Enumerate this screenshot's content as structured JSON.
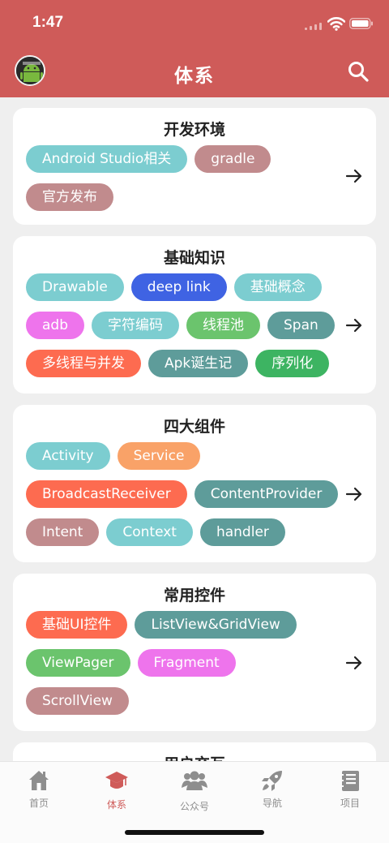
{
  "status_bar": {
    "time": "1:47"
  },
  "header": {
    "title": "体系"
  },
  "colors": {
    "primary": "#cf5b59",
    "teal_light": "#7ccdd0",
    "rose": "#c18b8d",
    "blue": "#3f63e3",
    "pink": "#ee74ec",
    "green": "#6bc46d",
    "teal_dark": "#5e9c9a",
    "orange_red": "#fd6b50",
    "green_dark": "#3db462",
    "orange": "#f9a268"
  },
  "cards": [
    {
      "title": "开发环境",
      "rows": [
        [
          "Android Studio相关",
          "gradle"
        ],
        [
          "官方发布"
        ]
      ]
    },
    {
      "title": "基础知识",
      "rows": [
        [
          "Drawable",
          "deep link",
          "基础概念"
        ],
        [
          "adb",
          "字符编码",
          "线程池",
          "Span"
        ],
        [
          "多线程与并发",
          "Apk诞生记",
          "序列化"
        ]
      ]
    },
    {
      "title": "四大组件",
      "rows": [
        [
          "Activity",
          "Service"
        ],
        [
          "BroadcastReceiver",
          "ContentProvider"
        ],
        [
          "Intent",
          "Context",
          "handler"
        ]
      ]
    },
    {
      "title": "常用控件",
      "rows": [
        [
          "基础UI控件",
          "ListView&GridView"
        ],
        [
          "ViewPager",
          "Fragment"
        ],
        [
          "ScrollView"
        ]
      ]
    },
    {
      "title": "用户交互",
      "rows": []
    }
  ],
  "tabbar": {
    "items": [
      {
        "label": "首页",
        "icon": "home-icon"
      },
      {
        "label": "体系",
        "icon": "graduation-cap-icon"
      },
      {
        "label": "公众号",
        "icon": "people-icon"
      },
      {
        "label": "导航",
        "icon": "rocket-icon"
      },
      {
        "label": "项目",
        "icon": "notebook-icon"
      }
    ],
    "active": "体系"
  }
}
